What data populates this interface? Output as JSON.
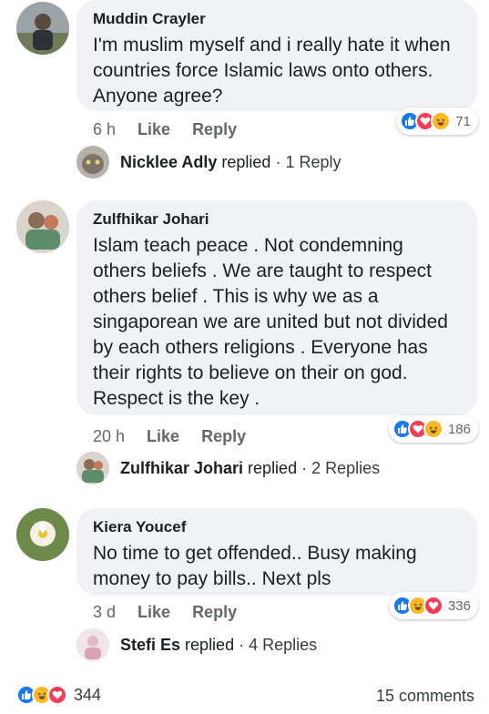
{
  "comments": [
    {
      "author": "Muddin Crayler",
      "text": "I'm muslim myself and i really hate it when countries force Islamic laws onto others. Anyone agree?",
      "time": "6 h",
      "like_label": "Like",
      "reply_label": "Reply",
      "reaction_count": "71",
      "reactions": [
        "like-icon",
        "love-icon",
        "haha-icon"
      ],
      "replied_name": "Nicklee Adly",
      "replied_text": "replied",
      "replies_count": "1 Reply"
    },
    {
      "author": "Zulfhikar Johari",
      "text": "Islam teach peace . Not condemning others beliefs . We are taught to respect others belief . This is why we as a singaporean we are united but not divided by each others religions . Everyone has their rights to believe on their on god. Respect is the key .",
      "time": "20 h",
      "like_label": "Like",
      "reply_label": "Reply",
      "reaction_count": "186",
      "reactions": [
        "like-icon",
        "love-icon",
        "haha-icon"
      ],
      "replied_name": "Zulfhikar Johari",
      "replied_text": "replied",
      "replies_count": "2 Replies"
    },
    {
      "author": "Kiera Youcef",
      "text": "No time to get offended.. Busy making money to pay bills.. Next pls",
      "time": "3 d",
      "like_label": "Like",
      "reply_label": "Reply",
      "reaction_count": "336",
      "reactions": [
        "like-icon",
        "haha-icon",
        "love-icon"
      ],
      "replied_name": "Stefi Es",
      "replied_text": "replied",
      "replies_count": "4 Replies"
    }
  ],
  "footer": {
    "reaction_total": "344",
    "comments_count": "15 comments"
  },
  "colors": {
    "like": "#1877f2",
    "love": "#f33e58",
    "haha": "#f7b928",
    "bubble": "#f0f2f5"
  }
}
